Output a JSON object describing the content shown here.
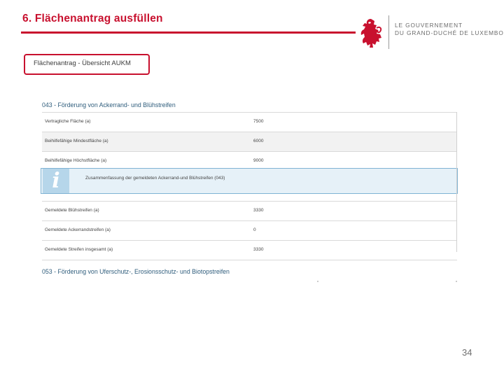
{
  "header": {
    "title": "6. Flächenantrag ausfüllen",
    "logo": {
      "line1": "LE GOUVERNEMENT",
      "line2": "DU GRAND-DUCHÉ DE LUXEMBOURG",
      "lion_color": "#c8102e"
    }
  },
  "tab": {
    "label": "Flächenantrag - Übersicht AUKM"
  },
  "section_1": {
    "title": "043 - Förderung von Ackerrand- und Blühstreifen",
    "rows": [
      {
        "label": "Vertragliche Fläche (a)",
        "value": "7500"
      },
      {
        "label": "Beihilfefähige Mindestfläche (a)",
        "value": "6000"
      },
      {
        "label": "Beihilfefähige Höchstfläche (a)",
        "value": "9000"
      }
    ],
    "info": {
      "icon": "i",
      "text": "Zusammenfassung der gemeldeten Ackerrand-und Blühstreifen (043)"
    },
    "summary_rows": [
      {
        "label": "Gemeldete Blühstreifen (a)",
        "value": "3330"
      },
      {
        "label": "Gemeldete Ackerrandstreifen (a)",
        "value": "0"
      },
      {
        "label": "Gemeldete Streifen insgesamt (a)",
        "value": "3330"
      }
    ]
  },
  "section_2": {
    "title": "053 - Förderung von Uferschutz-, Erosionsschutz- und Biotopstreifen"
  },
  "footer": {
    "page_number": "34"
  },
  "colors": {
    "accent": "#c8102e",
    "section_title": "#2f5d7c",
    "info_bg": "#e6f1f8",
    "info_border": "#7fb3d4"
  }
}
